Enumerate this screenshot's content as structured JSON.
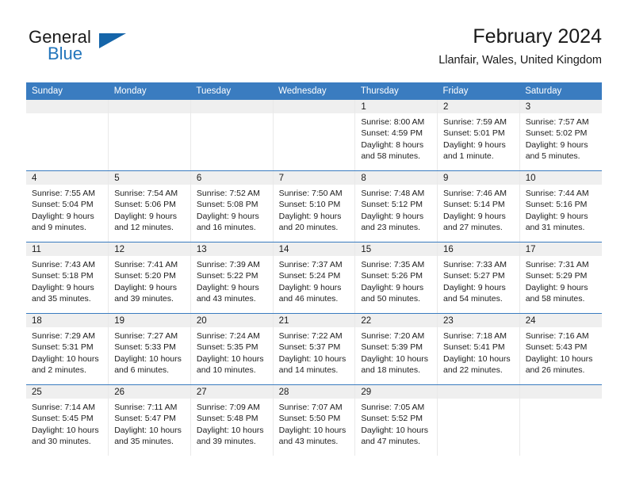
{
  "brand": {
    "name_part1": "General",
    "name_part2": "Blue",
    "logo_icon": "triangle-logo-icon",
    "accent_color": "#1565a9",
    "blue_text_color": "#2275bb"
  },
  "header": {
    "title": "February 2024",
    "location": "Llanfair, Wales, United Kingdom"
  },
  "calendar": {
    "header_bg": "#3a7cc0",
    "daynum_band_bg": "#efefef",
    "row_divider_color": "#3a7cc0",
    "weekday_headers": [
      "Sunday",
      "Monday",
      "Tuesday",
      "Wednesday",
      "Thursday",
      "Friday",
      "Saturday"
    ],
    "labels": {
      "sunrise": "Sunrise:",
      "sunset": "Sunset:",
      "daylight": "Daylight:"
    },
    "weeks": [
      [
        {
          "empty": true
        },
        {
          "empty": true
        },
        {
          "empty": true
        },
        {
          "empty": true
        },
        {
          "day": "1",
          "sunrise": "Sunrise: 8:00 AM",
          "sunset": "Sunset: 4:59 PM",
          "daylight_line1": "Daylight: 8 hours",
          "daylight_line2": "and 58 minutes."
        },
        {
          "day": "2",
          "sunrise": "Sunrise: 7:59 AM",
          "sunset": "Sunset: 5:01 PM",
          "daylight_line1": "Daylight: 9 hours",
          "daylight_line2": "and 1 minute."
        },
        {
          "day": "3",
          "sunrise": "Sunrise: 7:57 AM",
          "sunset": "Sunset: 5:02 PM",
          "daylight_line1": "Daylight: 9 hours",
          "daylight_line2": "and 5 minutes."
        }
      ],
      [
        {
          "day": "4",
          "sunrise": "Sunrise: 7:55 AM",
          "sunset": "Sunset: 5:04 PM",
          "daylight_line1": "Daylight: 9 hours",
          "daylight_line2": "and 9 minutes."
        },
        {
          "day": "5",
          "sunrise": "Sunrise: 7:54 AM",
          "sunset": "Sunset: 5:06 PM",
          "daylight_line1": "Daylight: 9 hours",
          "daylight_line2": "and 12 minutes."
        },
        {
          "day": "6",
          "sunrise": "Sunrise: 7:52 AM",
          "sunset": "Sunset: 5:08 PM",
          "daylight_line1": "Daylight: 9 hours",
          "daylight_line2": "and 16 minutes."
        },
        {
          "day": "7",
          "sunrise": "Sunrise: 7:50 AM",
          "sunset": "Sunset: 5:10 PM",
          "daylight_line1": "Daylight: 9 hours",
          "daylight_line2": "and 20 minutes."
        },
        {
          "day": "8",
          "sunrise": "Sunrise: 7:48 AM",
          "sunset": "Sunset: 5:12 PM",
          "daylight_line1": "Daylight: 9 hours",
          "daylight_line2": "and 23 minutes."
        },
        {
          "day": "9",
          "sunrise": "Sunrise: 7:46 AM",
          "sunset": "Sunset: 5:14 PM",
          "daylight_line1": "Daylight: 9 hours",
          "daylight_line2": "and 27 minutes."
        },
        {
          "day": "10",
          "sunrise": "Sunrise: 7:44 AM",
          "sunset": "Sunset: 5:16 PM",
          "daylight_line1": "Daylight: 9 hours",
          "daylight_line2": "and 31 minutes."
        }
      ],
      [
        {
          "day": "11",
          "sunrise": "Sunrise: 7:43 AM",
          "sunset": "Sunset: 5:18 PM",
          "daylight_line1": "Daylight: 9 hours",
          "daylight_line2": "and 35 minutes."
        },
        {
          "day": "12",
          "sunrise": "Sunrise: 7:41 AM",
          "sunset": "Sunset: 5:20 PM",
          "daylight_line1": "Daylight: 9 hours",
          "daylight_line2": "and 39 minutes."
        },
        {
          "day": "13",
          "sunrise": "Sunrise: 7:39 AM",
          "sunset": "Sunset: 5:22 PM",
          "daylight_line1": "Daylight: 9 hours",
          "daylight_line2": "and 43 minutes."
        },
        {
          "day": "14",
          "sunrise": "Sunrise: 7:37 AM",
          "sunset": "Sunset: 5:24 PM",
          "daylight_line1": "Daylight: 9 hours",
          "daylight_line2": "and 46 minutes."
        },
        {
          "day": "15",
          "sunrise": "Sunrise: 7:35 AM",
          "sunset": "Sunset: 5:26 PM",
          "daylight_line1": "Daylight: 9 hours",
          "daylight_line2": "and 50 minutes."
        },
        {
          "day": "16",
          "sunrise": "Sunrise: 7:33 AM",
          "sunset": "Sunset: 5:27 PM",
          "daylight_line1": "Daylight: 9 hours",
          "daylight_line2": "and 54 minutes."
        },
        {
          "day": "17",
          "sunrise": "Sunrise: 7:31 AM",
          "sunset": "Sunset: 5:29 PM",
          "daylight_line1": "Daylight: 9 hours",
          "daylight_line2": "and 58 minutes."
        }
      ],
      [
        {
          "day": "18",
          "sunrise": "Sunrise: 7:29 AM",
          "sunset": "Sunset: 5:31 PM",
          "daylight_line1": "Daylight: 10 hours",
          "daylight_line2": "and 2 minutes."
        },
        {
          "day": "19",
          "sunrise": "Sunrise: 7:27 AM",
          "sunset": "Sunset: 5:33 PM",
          "daylight_line1": "Daylight: 10 hours",
          "daylight_line2": "and 6 minutes."
        },
        {
          "day": "20",
          "sunrise": "Sunrise: 7:24 AM",
          "sunset": "Sunset: 5:35 PM",
          "daylight_line1": "Daylight: 10 hours",
          "daylight_line2": "and 10 minutes."
        },
        {
          "day": "21",
          "sunrise": "Sunrise: 7:22 AM",
          "sunset": "Sunset: 5:37 PM",
          "daylight_line1": "Daylight: 10 hours",
          "daylight_line2": "and 14 minutes."
        },
        {
          "day": "22",
          "sunrise": "Sunrise: 7:20 AM",
          "sunset": "Sunset: 5:39 PM",
          "daylight_line1": "Daylight: 10 hours",
          "daylight_line2": "and 18 minutes."
        },
        {
          "day": "23",
          "sunrise": "Sunrise: 7:18 AM",
          "sunset": "Sunset: 5:41 PM",
          "daylight_line1": "Daylight: 10 hours",
          "daylight_line2": "and 22 minutes."
        },
        {
          "day": "24",
          "sunrise": "Sunrise: 7:16 AM",
          "sunset": "Sunset: 5:43 PM",
          "daylight_line1": "Daylight: 10 hours",
          "daylight_line2": "and 26 minutes."
        }
      ],
      [
        {
          "day": "25",
          "sunrise": "Sunrise: 7:14 AM",
          "sunset": "Sunset: 5:45 PM",
          "daylight_line1": "Daylight: 10 hours",
          "daylight_line2": "and 30 minutes."
        },
        {
          "day": "26",
          "sunrise": "Sunrise: 7:11 AM",
          "sunset": "Sunset: 5:47 PM",
          "daylight_line1": "Daylight: 10 hours",
          "daylight_line2": "and 35 minutes."
        },
        {
          "day": "27",
          "sunrise": "Sunrise: 7:09 AM",
          "sunset": "Sunset: 5:48 PM",
          "daylight_line1": "Daylight: 10 hours",
          "daylight_line2": "and 39 minutes."
        },
        {
          "day": "28",
          "sunrise": "Sunrise: 7:07 AM",
          "sunset": "Sunset: 5:50 PM",
          "daylight_line1": "Daylight: 10 hours",
          "daylight_line2": "and 43 minutes."
        },
        {
          "day": "29",
          "sunrise": "Sunrise: 7:05 AM",
          "sunset": "Sunset: 5:52 PM",
          "daylight_line1": "Daylight: 10 hours",
          "daylight_line2": "and 47 minutes."
        },
        {
          "empty": true
        },
        {
          "empty": true
        }
      ]
    ]
  }
}
